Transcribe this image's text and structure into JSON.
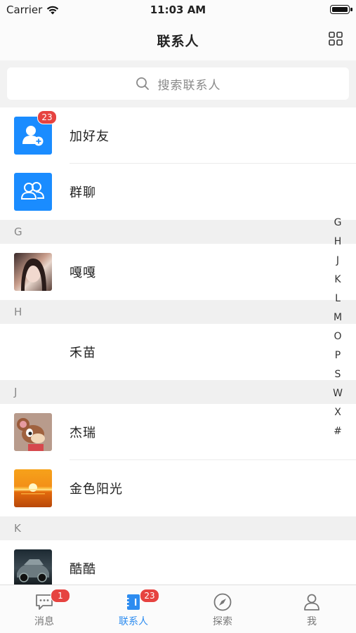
{
  "status_bar": {
    "carrier": "Carrier",
    "time": "11:03 AM"
  },
  "nav": {
    "title": "联系人"
  },
  "search": {
    "placeholder": "搜索联系人"
  },
  "top_actions": [
    {
      "label": "加好友",
      "badge": "23"
    },
    {
      "label": "群聊"
    }
  ],
  "sections": [
    {
      "letter": "G",
      "contacts": [
        {
          "name": "嘎嘎"
        }
      ]
    },
    {
      "letter": "H",
      "contacts": [
        {
          "name": "禾苗"
        }
      ]
    },
    {
      "letter": "J",
      "contacts": [
        {
          "name": "杰瑞"
        },
        {
          "name": "金色阳光"
        }
      ]
    },
    {
      "letter": "K",
      "contacts": [
        {
          "name": "酷酷"
        }
      ]
    }
  ],
  "index_letters": [
    "G",
    "H",
    "J",
    "K",
    "L",
    "M",
    "O",
    "P",
    "S",
    "W",
    "X",
    "#"
  ],
  "tabs": [
    {
      "label": "消息",
      "badge": "1"
    },
    {
      "label": "联系人",
      "badge": "23"
    },
    {
      "label": "探索"
    },
    {
      "label": "我"
    }
  ],
  "colors": {
    "accent": "#2d8cf0",
    "badge": "#e64340",
    "icon_blue": "#1a8cff"
  }
}
